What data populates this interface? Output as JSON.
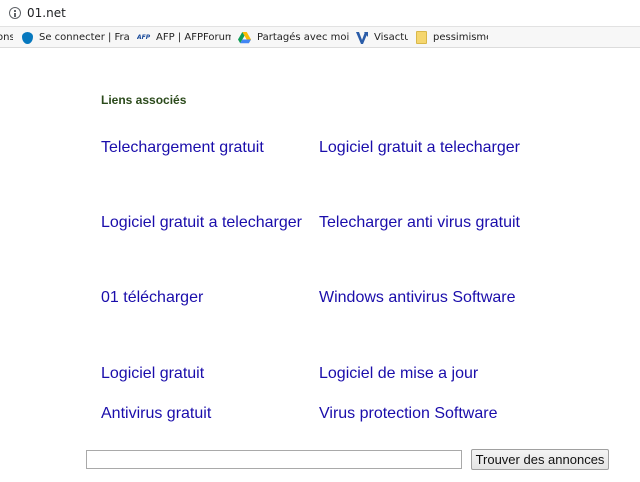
{
  "address_bar": {
    "url": "01.net",
    "icon": "info-icon"
  },
  "bookmarks": [
    {
      "label": "ons",
      "icon": "none"
    },
    {
      "label": "Se connecter | France",
      "icon": "drupal-icon"
    },
    {
      "label": "AFP | AFPForum |",
      "icon": "afp-icon",
      "icon_text": "AFP"
    },
    {
      "label": "Partagés avec moi - G",
      "icon": "google-drive-icon"
    },
    {
      "label": "Visactu",
      "icon": "visactu-icon"
    },
    {
      "label": "pessimisme",
      "icon": "folder-icon"
    }
  ],
  "content": {
    "title": "Liens associés",
    "links_left": [
      "Telechargement gratuit",
      "Logiciel gratuit a telecharger",
      "01 télécharger",
      "Logiciel gratuit",
      "Antivirus gratuit"
    ],
    "links_right": [
      "Logiciel gratuit a telecharger",
      "Telecharger anti virus gratuit",
      "Windows antivirus Software",
      "Logiciel de mise a jour",
      "Virus protection Software"
    ]
  },
  "search": {
    "value": "",
    "button_label": "Trouver des annonces"
  },
  "colors": {
    "link": "#1a0dab",
    "title": "#2b4a1b"
  }
}
